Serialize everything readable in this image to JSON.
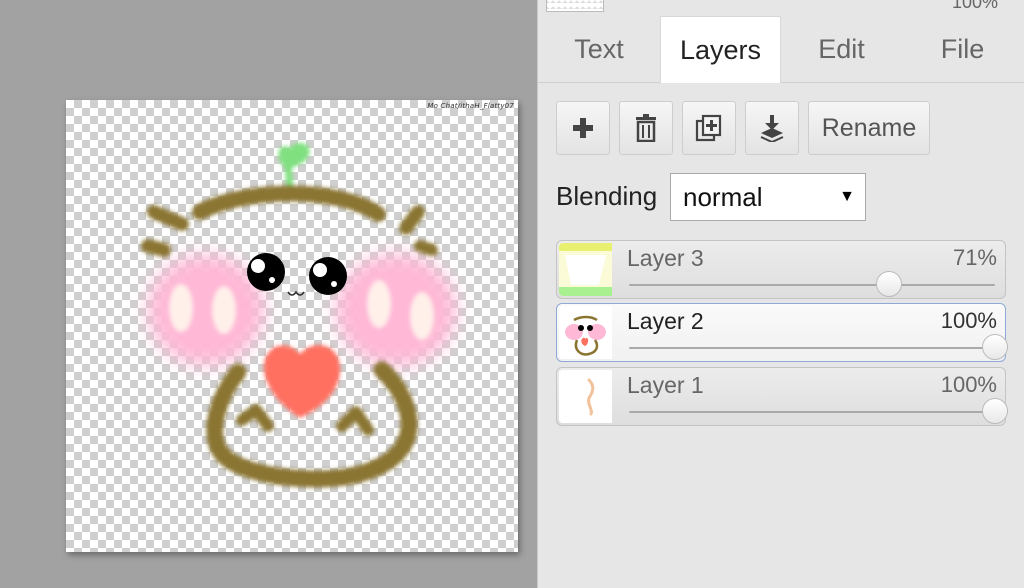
{
  "canvas": {
    "signature": "Mo Chat/ithaH_Flatty07"
  },
  "panel": {
    "top_value": "100%",
    "tabs": [
      {
        "label": "Text",
        "active": false
      },
      {
        "label": "Layers",
        "active": true
      },
      {
        "label": "Edit",
        "active": false
      },
      {
        "label": "File",
        "active": false
      }
    ],
    "toolbar": {
      "add_icon": "plus-icon",
      "delete_icon": "trash-icon",
      "duplicate_icon": "duplicate-icon",
      "merge_icon": "merge-down-icon",
      "rename_label": "Rename"
    },
    "blending": {
      "label": "Blending",
      "value": "normal"
    },
    "layers": [
      {
        "name": "Layer 3",
        "opacity": "71%",
        "opacity_fraction": 0.71,
        "selected": false
      },
      {
        "name": "Layer 2",
        "opacity": "100%",
        "opacity_fraction": 1.0,
        "selected": true
      },
      {
        "name": "Layer 1",
        "opacity": "100%",
        "opacity_fraction": 1.0,
        "selected": false
      }
    ]
  },
  "colors": {
    "selection_border": "#8fa8d8",
    "drawing_brown": "#8a7430",
    "heart": "#ff7060",
    "blush": "#ffb8d0",
    "sprout": "#80e080"
  }
}
